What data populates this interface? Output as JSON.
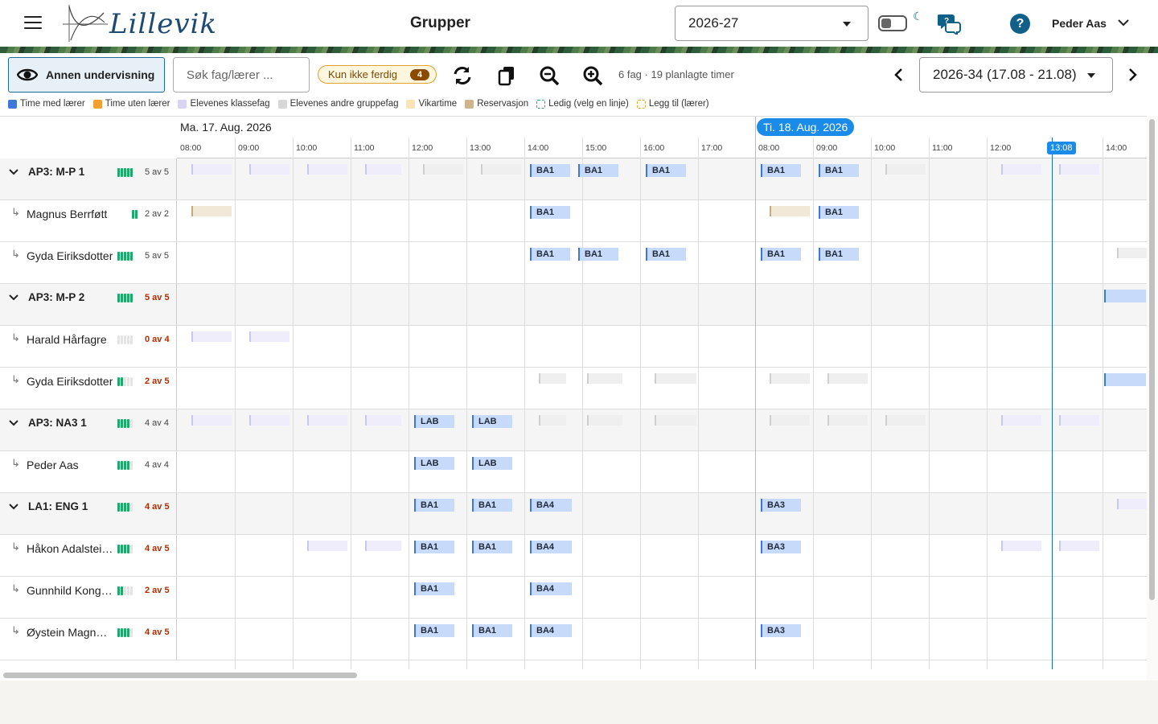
{
  "header": {
    "brand": "Lillevik",
    "title": "Grupper",
    "school_year": "2026-27",
    "user_name": "Peder Aas"
  },
  "toolbar": {
    "other_teaching_label": "Annen undervisning",
    "search_placeholder": "Søk fag/lærer ...",
    "filter_chip_label": "Kun ikke ferdig",
    "filter_chip_count": "4",
    "summary": "6 fag · 19 planlagte timer",
    "week_select": "2026-34 (17.08 - 21.08)"
  },
  "legend": [
    {
      "label": "Time med lærer",
      "color": "#3b78d8"
    },
    {
      "label": "Time uten lærer",
      "color": "#f0a030"
    },
    {
      "label": "Elevenes klassefag",
      "color": "#d9d3f5"
    },
    {
      "label": "Elevenes andre gruppefag",
      "color": "#d7d7d7"
    },
    {
      "label": "Vikartime",
      "color": "#fbe3b5"
    },
    {
      "label": "Reservasjon",
      "color": "#cfb48e"
    },
    {
      "label": "Ledig (velg en linje)",
      "color": "#2ea86b"
    },
    {
      "label": "Legg til (lærer)",
      "color": "#f0a030"
    }
  ],
  "schedule": {
    "day1": "Ma. 17. Aug. 2026",
    "day2": "Ti. 18. Aug. 2026",
    "now_time": "13:08",
    "hours_day1": [
      "08:00",
      "09:00",
      "10:00",
      "11:00",
      "12:00",
      "13:00",
      "14:00",
      "15:00",
      "16:00",
      "17:00"
    ],
    "hours_day2": [
      "08:00",
      "09:00",
      "10:00",
      "11:00",
      "12:00",
      "14:00"
    ]
  },
  "rows": [
    {
      "type": "group",
      "name": "AP3: M-P 1",
      "done": 5,
      "total": 5,
      "count_text": "5 av 5",
      "warn": false
    },
    {
      "type": "member",
      "name": "Magnus Berrføtt",
      "done": 2,
      "total": 2,
      "count_text": "2 av 2",
      "warn": false
    },
    {
      "type": "member",
      "name": "Gyda Eiriksdotter",
      "done": 5,
      "total": 5,
      "count_text": "5 av 5",
      "warn": false
    },
    {
      "type": "group",
      "name": "AP3: M-P 2",
      "done": 5,
      "total": 5,
      "count_text": "5 av 5",
      "warn": true
    },
    {
      "type": "member",
      "name": "Harald Hårfagre",
      "done": 0,
      "total": 4,
      "count_text": "0 av 4",
      "warn": true
    },
    {
      "type": "member",
      "name": "Gyda Eiriksdotter",
      "done": 2,
      "total": 5,
      "count_text": "2 av 5",
      "warn": true
    },
    {
      "type": "group",
      "name": "AP3: NA3 1",
      "done": 4,
      "total": 4,
      "count_text": "4 av 4",
      "warn": false
    },
    {
      "type": "member",
      "name": "Peder Aas",
      "done": 4,
      "total": 4,
      "count_text": "4 av 4",
      "warn": false
    },
    {
      "type": "group",
      "name": "LA1: ENG 1",
      "done": 4,
      "total": 5,
      "count_text": "4 av 5",
      "warn": true
    },
    {
      "type": "member",
      "name": "Håkon Adalstei…",
      "done": 4,
      "total": 5,
      "count_text": "4 av 5",
      "warn": true
    },
    {
      "type": "member",
      "name": "Gunnhild Kong…",
      "done": 2,
      "total": 5,
      "count_text": "2 av 5",
      "warn": true
    },
    {
      "type": "member",
      "name": "Øystein Magnu…",
      "done": 4,
      "total": 5,
      "count_text": "4 av 5",
      "warn": true
    }
  ],
  "lessons": [
    {
      "row": 0,
      "slot": "d1-14:00",
      "label": "BA1"
    },
    {
      "row": 0,
      "slot": "d1-14:50",
      "label": "BA1"
    },
    {
      "row": 0,
      "slot": "d1-16:00",
      "label": "BA1"
    },
    {
      "row": 0,
      "slot": "d2-08:00",
      "label": "BA1"
    },
    {
      "row": 0,
      "slot": "d2-09:00",
      "label": "BA1"
    },
    {
      "row": 1,
      "slot": "d1-14:00",
      "label": "BA1"
    },
    {
      "row": 1,
      "slot": "d2-09:00",
      "label": "BA1"
    },
    {
      "row": 2,
      "slot": "d1-14:00",
      "label": "BA1"
    },
    {
      "row": 2,
      "slot": "d1-14:50",
      "label": "BA1"
    },
    {
      "row": 2,
      "slot": "d1-16:00",
      "label": "BA1"
    },
    {
      "row": 2,
      "slot": "d2-08:00",
      "label": "BA1"
    },
    {
      "row": 2,
      "slot": "d2-09:00",
      "label": "BA1"
    },
    {
      "row": 6,
      "slot": "d1-12:00",
      "label": "LAB"
    },
    {
      "row": 6,
      "slot": "d1-13:00",
      "label": "LAB"
    },
    {
      "row": 7,
      "slot": "d1-12:00",
      "label": "LAB"
    },
    {
      "row": 7,
      "slot": "d1-13:00",
      "label": "LAB"
    },
    {
      "row": 8,
      "slot": "d1-12:00",
      "label": "BA1"
    },
    {
      "row": 8,
      "slot": "d1-13:00",
      "label": "BA1"
    },
    {
      "row": 8,
      "slot": "d1-14:00",
      "label": "BA4"
    },
    {
      "row": 8,
      "slot": "d2-08:00",
      "label": "BA3"
    },
    {
      "row": 9,
      "slot": "d1-12:00",
      "label": "BA1"
    },
    {
      "row": 9,
      "slot": "d1-13:00",
      "label": "BA1"
    },
    {
      "row": 9,
      "slot": "d1-14:00",
      "label": "BA4"
    },
    {
      "row": 9,
      "slot": "d2-08:00",
      "label": "BA3"
    },
    {
      "row": 10,
      "slot": "d1-12:00",
      "label": "BA1"
    },
    {
      "row": 10,
      "slot": "d1-14:00",
      "label": "BA4"
    },
    {
      "row": 11,
      "slot": "d1-12:00",
      "label": "BA1"
    },
    {
      "row": 11,
      "slot": "d1-13:00",
      "label": "BA1"
    },
    {
      "row": 11,
      "slot": "d1-14:00",
      "label": "BA4"
    },
    {
      "row": 11,
      "slot": "d2-08:00",
      "label": "BA3"
    }
  ]
}
